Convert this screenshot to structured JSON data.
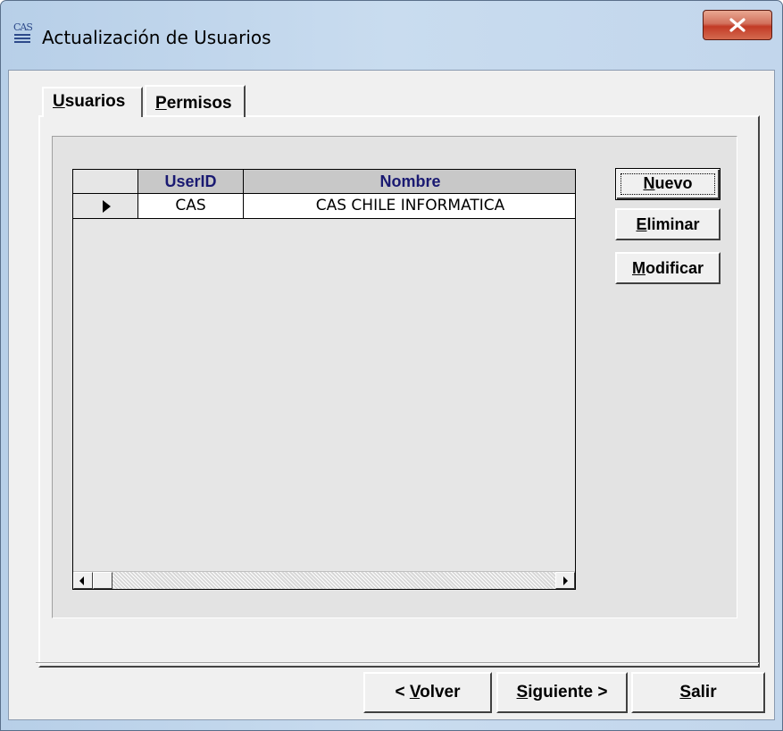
{
  "window": {
    "title": "Actualización de Usuarios",
    "icon": "cas-app-icon",
    "icon_text": "CAS"
  },
  "tabs": [
    {
      "label": "Usuarios",
      "accel": "U",
      "rest": "suarios",
      "active": true
    },
    {
      "label": "Permisos",
      "accel": "P",
      "rest": "ermisos",
      "active": false
    }
  ],
  "grid": {
    "columns": [
      "UserID",
      "Nombre"
    ],
    "rows": [
      {
        "userid": "CAS",
        "nombre": "CAS CHILE INFORMATICA",
        "current": true
      }
    ]
  },
  "side_buttons": {
    "nuevo": {
      "label": "Nuevo",
      "accel": "N",
      "rest": "uevo"
    },
    "eliminar": {
      "label": "Eliminar",
      "accel": "E",
      "rest": "liminar"
    },
    "modificar": {
      "label": "Modificar",
      "accel": "M",
      "rest": "odificar"
    }
  },
  "bottom_buttons": {
    "volver": {
      "label": "< Volver",
      "prefix": "< ",
      "accel": "V",
      "rest": "olver"
    },
    "siguiente": {
      "label": "Siguiente >",
      "accel": "S",
      "rest": "iguiente >"
    },
    "salir": {
      "label": "Salir",
      "accel": "S",
      "rest": "alir"
    }
  },
  "colors": {
    "titlebar": "#c2d6ec",
    "close_button": "#c9452f",
    "header_text": "#1a1a72",
    "header_bg": "#c8c8c8",
    "client_bg": "#f0f0f0"
  }
}
